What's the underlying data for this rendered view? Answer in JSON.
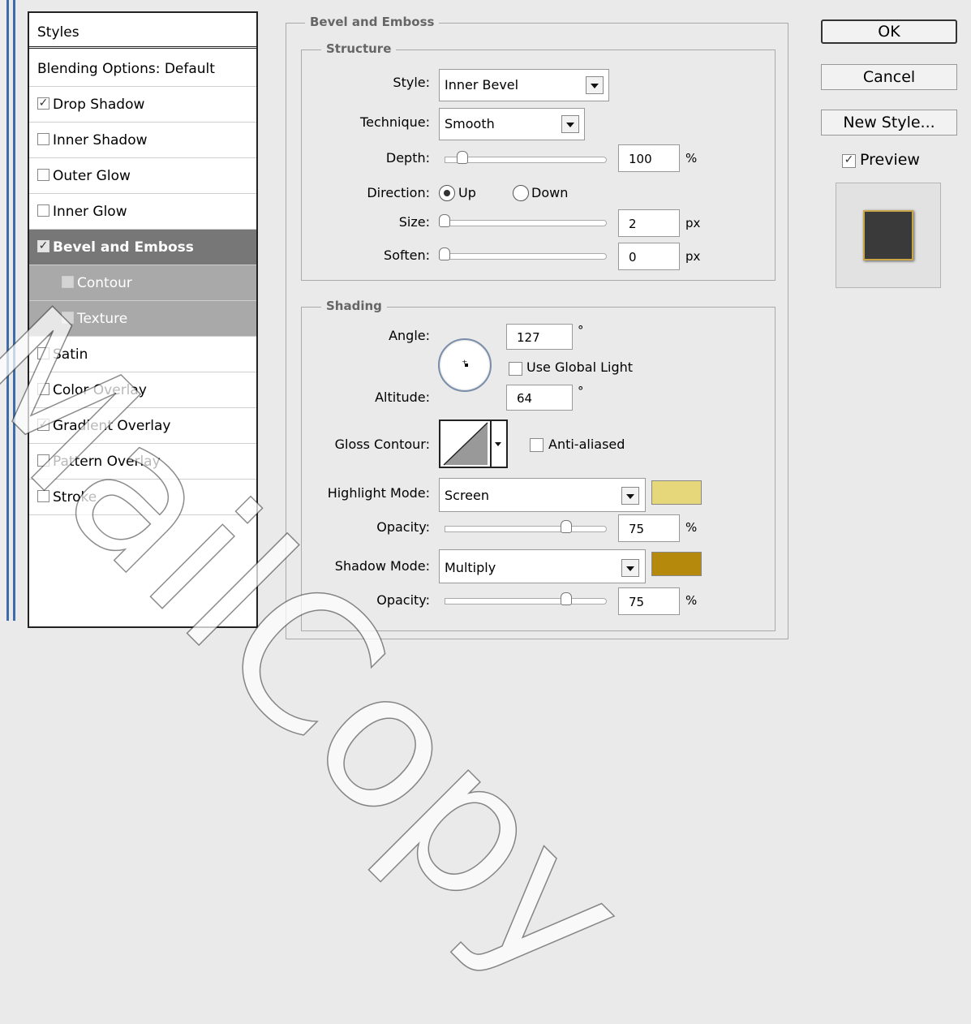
{
  "styles_list": {
    "header": "Styles",
    "blending_options": "Blending Options: Default",
    "items": [
      {
        "label": "Drop Shadow",
        "checked": true
      },
      {
        "label": "Inner Shadow",
        "checked": false
      },
      {
        "label": "Outer Glow",
        "checked": false
      },
      {
        "label": "Inner Glow",
        "checked": false
      },
      {
        "label": "Bevel and Emboss",
        "checked": true,
        "selected": true
      },
      {
        "label": "Contour",
        "checked": false
      },
      {
        "label": "Texture",
        "checked": false
      },
      {
        "label": "Satin",
        "checked": false
      },
      {
        "label": "Color Overlay",
        "checked": false
      },
      {
        "label": "Gradient Overlay",
        "checked": true
      },
      {
        "label": "Pattern Overlay",
        "checked": false
      },
      {
        "label": "Stroke",
        "checked": false
      }
    ]
  },
  "bevel": {
    "title": "Bevel and Emboss",
    "structure": {
      "title": "Structure",
      "style_label": "Style:",
      "style_value": "Inner Bevel",
      "technique_label": "Technique:",
      "technique_value": "Smooth",
      "depth_label": "Depth:",
      "depth_value": "100",
      "depth_unit": "%",
      "depth_slider_fraction": 0.11,
      "direction_label": "Direction:",
      "direction_up": "Up",
      "direction_down": "Down",
      "direction_selected": "Up",
      "size_label": "Size:",
      "size_value": "2",
      "size_unit": "px",
      "soften_label": "Soften:",
      "soften_value": "0",
      "soften_unit": "px"
    },
    "shading": {
      "title": "Shading",
      "angle_label": "Angle:",
      "angle_value": "127",
      "angle_unit": "°",
      "use_global_light": "Use Global Light",
      "use_global_light_checked": false,
      "altitude_label": "Altitude:",
      "altitude_value": "64",
      "altitude_unit": "°",
      "gloss_contour_label": "Gloss Contour:",
      "anti_aliased": "Anti-aliased",
      "anti_aliased_checked": false,
      "highlight_mode_label": "Highlight Mode:",
      "highlight_mode_value": "Screen",
      "highlight_color": "#e6d77a",
      "highlight_opacity_label": "Opacity:",
      "highlight_opacity_value": "75",
      "highlight_opacity_unit": "%",
      "shadow_mode_label": "Shadow Mode:",
      "shadow_mode_value": "Multiply",
      "shadow_color": "#b58a0c",
      "shadow_opacity_label": "Opacity:",
      "shadow_opacity_value": "75",
      "shadow_opacity_unit": "%"
    }
  },
  "buttons": {
    "ok": "OK",
    "cancel": "Cancel",
    "new_style": "New Style...",
    "preview": "Preview",
    "preview_checked": true
  },
  "watermark": "MailCopy"
}
